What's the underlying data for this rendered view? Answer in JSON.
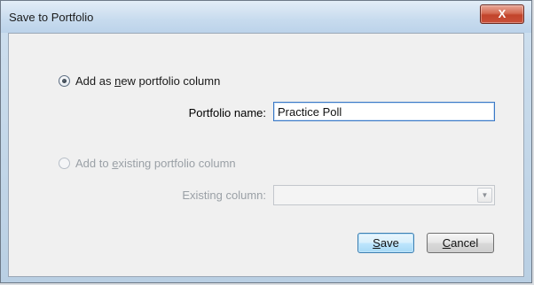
{
  "window": {
    "title": "Save to Portfolio",
    "close_label": "X"
  },
  "options": {
    "new_column": {
      "label_pre": "Add as ",
      "label_mnemonic": "n",
      "label_post": "ew portfolio column",
      "selected": true
    },
    "existing_column": {
      "label_pre": "Add to ",
      "label_mnemonic": "e",
      "label_post": "xisting portfolio column",
      "selected": false
    }
  },
  "fields": {
    "portfolio_name_label": "Portfolio name:",
    "portfolio_name_value": "Practice Poll",
    "existing_column_label": "Existing column:",
    "existing_column_value": ""
  },
  "buttons": {
    "save_mnemonic": "S",
    "save_rest": "ave",
    "cancel_mnemonic": "C",
    "cancel_rest": "ancel"
  }
}
